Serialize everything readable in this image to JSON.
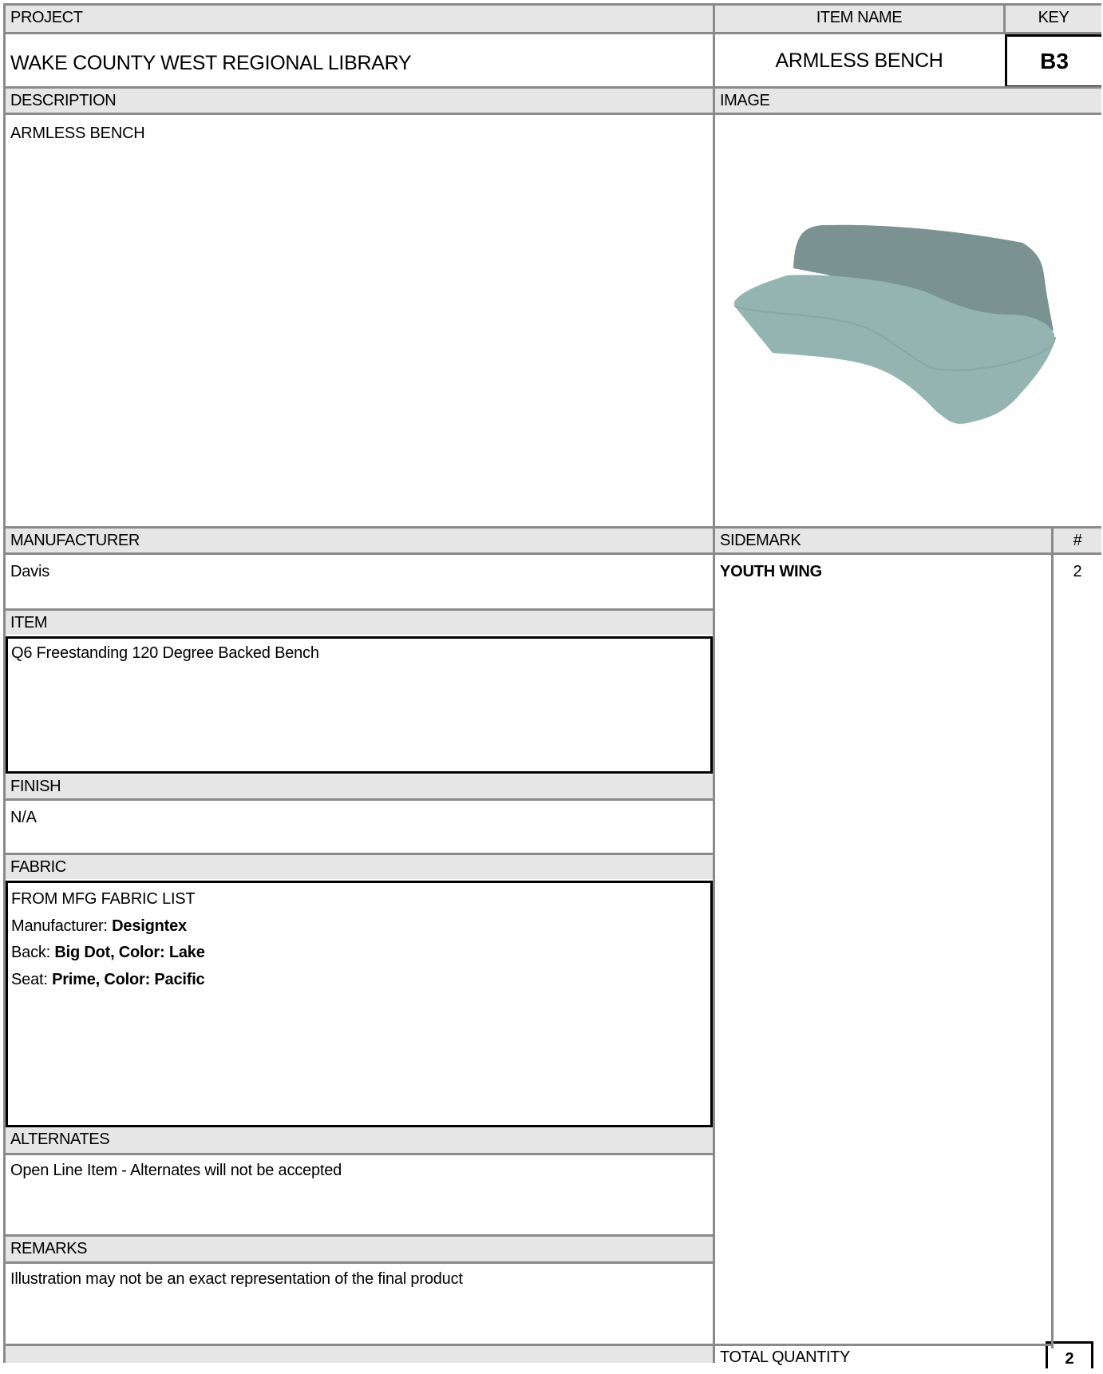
{
  "headers": {
    "project": "PROJECT",
    "item_name": "ITEM NAME",
    "key": "KEY",
    "description": "DESCRIPTION",
    "image": "IMAGE",
    "manufacturer": "MANUFACTURER",
    "sidemark": "SIDEMARK",
    "number": "#",
    "item": "ITEM",
    "finish": "FINISH",
    "fabric": "FABRIC",
    "alternates": "ALTERNATES",
    "remarks": "REMARKS",
    "total_quantity": "TOTAL QUANTITY"
  },
  "values": {
    "project": "WAKE COUNTY WEST REGIONAL LIBRARY",
    "item_name": "ARMLESS BENCH",
    "key": "B3",
    "description": "ARMLESS BENCH",
    "manufacturer": "Davis",
    "sidemark": "YOUTH WING",
    "sidemark_qty": "2",
    "item": "Q6 Freestanding 120 Degree Backed Bench",
    "finish": "N/A",
    "fabric": {
      "line1": "FROM MFG FABRIC LIST",
      "manufacturer_label": "Manufacturer: ",
      "manufacturer_value": "Designtex",
      "back_label": "Back: ",
      "back_value": "Big Dot, Color: Lake",
      "seat_label": "Seat: ",
      "seat_value": "Prime, Color: Pacific"
    },
    "alternates": "Open Line Item - Alternates will not be accepted",
    "remarks": "Illustration may not be an exact representation of the final product",
    "total_quantity": "2"
  },
  "image": {
    "subject": "bench-illustration",
    "back_color": "#7a9392",
    "seat_color": "#94b4b2",
    "seat_edge_color": "#86a8a6"
  }
}
